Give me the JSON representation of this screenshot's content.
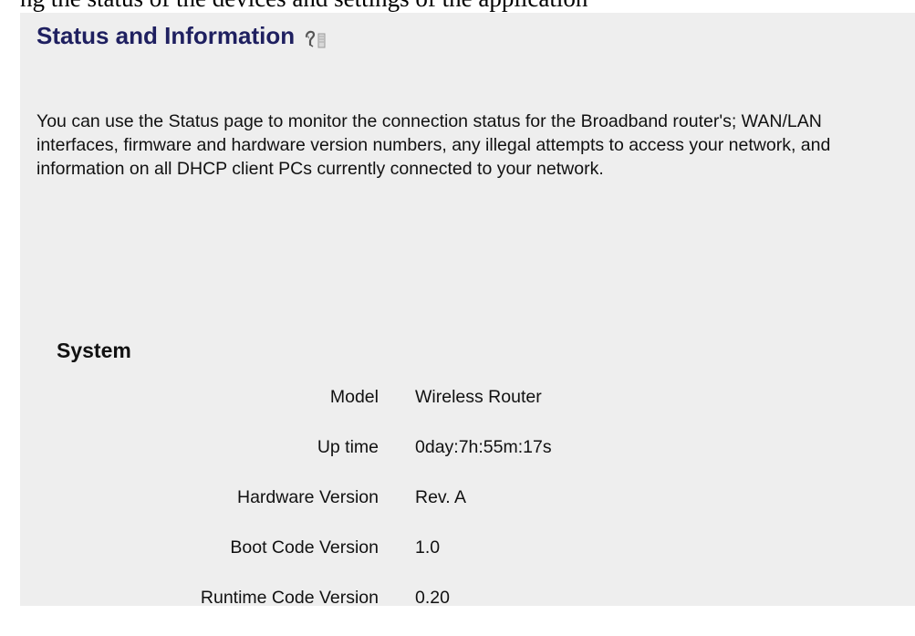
{
  "page": {
    "clipped_top_text": "ng the status of the devices and settings of the application",
    "title": "Status and Information",
    "help_icon": "help-icon",
    "intro": "You can use the Status page to monitor the connection status for the Broadband router's; WAN/LAN interfaces, firmware and hardware version numbers, any illegal attempts to access your network, and information on all DHCP client PCs currently connected to your network."
  },
  "system": {
    "heading": "System",
    "rows": [
      {
        "label": "Model",
        "value": "Wireless Router"
      },
      {
        "label": "Up time",
        "value": "0day:7h:55m:17s"
      },
      {
        "label": "Hardware Version",
        "value": "Rev. A"
      },
      {
        "label": "Boot Code Version",
        "value": "1.0"
      },
      {
        "label": "Runtime Code Version",
        "value": "0.20"
      }
    ]
  },
  "colors": {
    "title": "#1f2060",
    "panel_background": "#eeeeee",
    "text": "#111111"
  }
}
